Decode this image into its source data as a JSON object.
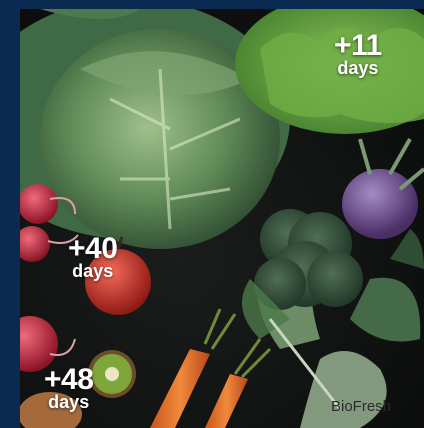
{
  "badges": [
    {
      "value": "+11",
      "unit": "days"
    },
    {
      "value": "+40",
      "unit": "days"
    },
    {
      "value": "+48",
      "unit": "days"
    }
  ],
  "brand": "BioFresh",
  "colors": {
    "frame_border": "#0b2a52",
    "background": "#0e100f",
    "badge_text": "#ffffff"
  }
}
